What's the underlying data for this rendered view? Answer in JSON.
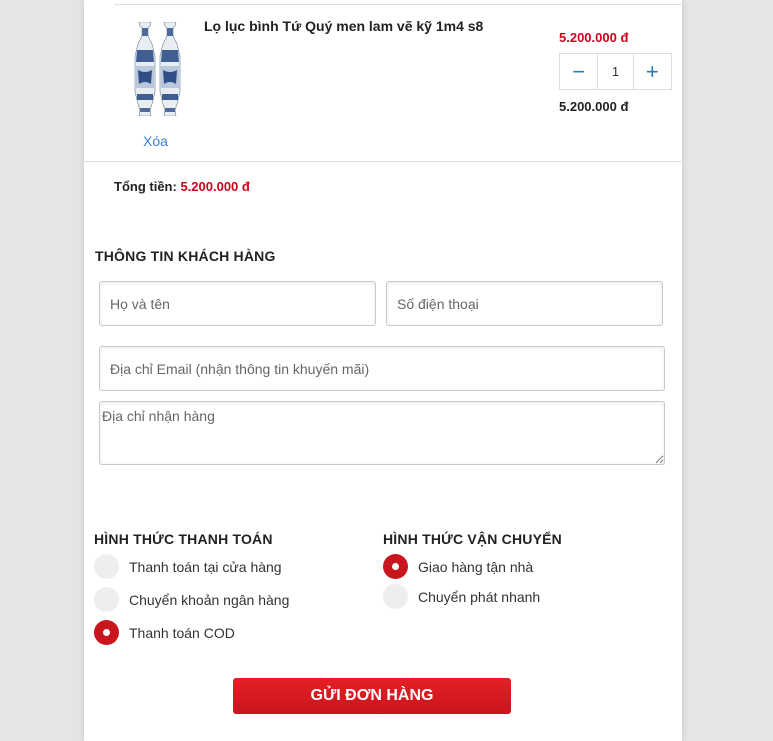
{
  "cart": {
    "item": {
      "name": "Lọ lục bình Tứ Quý men lam vẽ kỹ 1m4 s8",
      "remove_label": "Xóa",
      "unit_price": "5.200.000 đ",
      "quantity": "1",
      "line_total": "5.200.000 đ",
      "decrease_icon": "minus-icon",
      "increase_icon": "plus-icon",
      "decrease_symbol": "−",
      "increase_symbol": "+"
    },
    "total_label": "Tổng tiền:",
    "total_value": "5.200.000 đ"
  },
  "customer": {
    "title": "THÔNG TIN KHÁCH HÀNG",
    "name_placeholder": "Họ và tên",
    "phone_placeholder": "Số điện thoại",
    "email_placeholder": "Địa chỉ Email (nhận thông tin khuyến mãi)",
    "address_placeholder": "Địa chỉ nhận hàng"
  },
  "payment": {
    "title": "HÌNH THỨC THANH TOÁN",
    "options": [
      {
        "label": "Thanh toán tại cửa hàng",
        "selected": false
      },
      {
        "label": "Chuyển khoản ngân hàng",
        "selected": false
      },
      {
        "label": "Thanh toán COD",
        "selected": true
      }
    ]
  },
  "shipping": {
    "title": "HÌNH THỨC VẬN CHUYỂN",
    "options": [
      {
        "label": "Giao hàng tận nhà",
        "selected": true
      },
      {
        "label": "Chuyển phát nhanh",
        "selected": false
      }
    ]
  },
  "submit_label": "GỬI ĐƠN HÀNG",
  "colors": {
    "accent": "#d0021b",
    "button": "#c9151e",
    "link": "#3b7fd1",
    "qty_icon": "#2a7bb5"
  }
}
